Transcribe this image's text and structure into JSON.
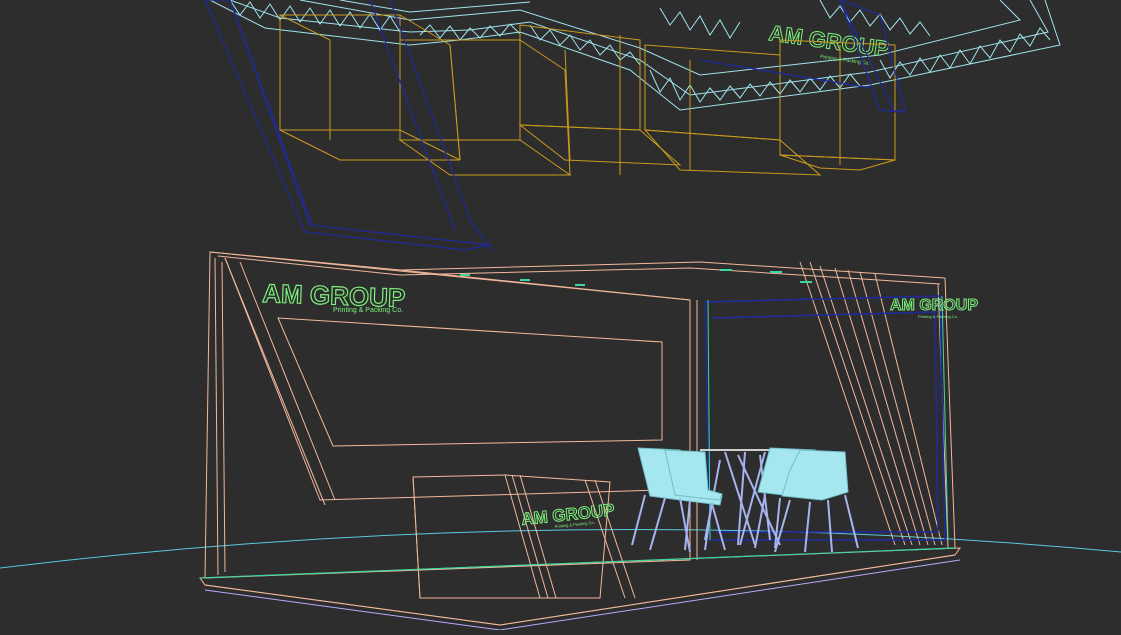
{
  "scene": {
    "background": "#2d2d2d",
    "colors": {
      "truss": "#9fe3ec",
      "light_box": "#c99a1e",
      "header_frame": "#1f2aa0",
      "booth_structure": "#f2b89a",
      "logo_green": "#7cf07c",
      "accent_teal": "#3fd7a0",
      "chair": "#a6e6ee",
      "chair_legs": "#a8b4f0",
      "floor_grid": "#58cbe0",
      "floor_base": "#b9a8ff"
    }
  },
  "logos": {
    "main": {
      "brand": "AM GROUP",
      "tagline": "Printing & Packing Co."
    },
    "side": {
      "brand": "AM GROUP",
      "tagline": "Printing & Packing Co."
    },
    "counter": {
      "brand": "AM GROUP",
      "tagline": "Printing & Packing Co."
    },
    "truss": {
      "brand": "AM GROUP",
      "tagline": "Printing & Packing Co."
    }
  },
  "furniture": {
    "chairs": 4,
    "tables": 1
  }
}
